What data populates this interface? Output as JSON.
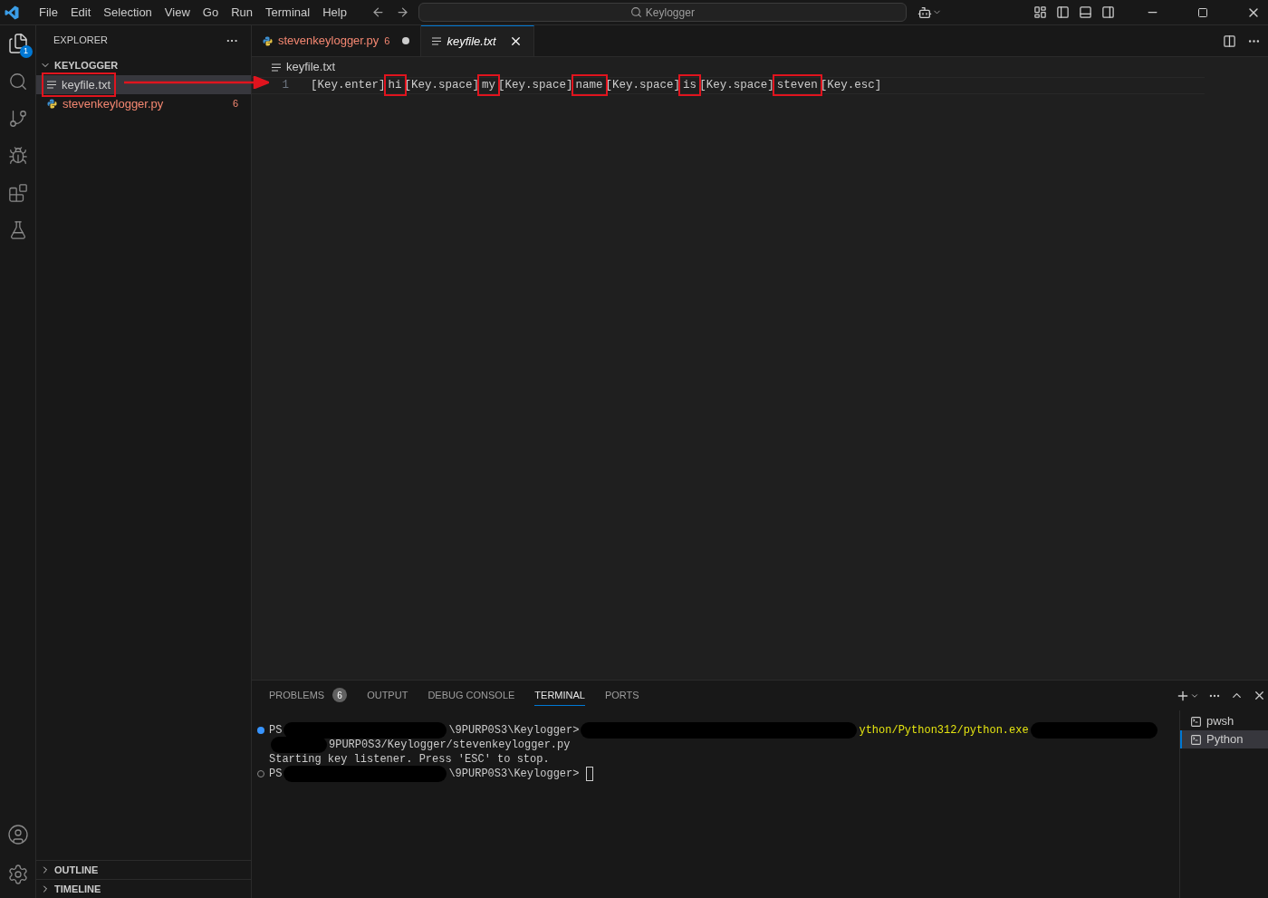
{
  "menu": [
    "File",
    "Edit",
    "Selection",
    "View",
    "Go",
    "Run",
    "Terminal",
    "Help"
  ],
  "command_center": {
    "value": "Keylogger"
  },
  "activity_bar": {
    "explorer_badge": "1"
  },
  "sidebar": {
    "title": "EXPLORER",
    "more": "···",
    "folder": {
      "label": "KEYLOGGER",
      "expanded": true,
      "items": [
        {
          "label": "keyfile.txt",
          "kind": "text",
          "selected": true,
          "annotated": true
        },
        {
          "label": "stevenkeylogger.py",
          "kind": "python",
          "selected": false,
          "annotated": false,
          "problems": "6"
        }
      ]
    },
    "sections": [
      {
        "label": "OUTLINE",
        "expanded": false
      },
      {
        "label": "TIMELINE",
        "expanded": false
      }
    ]
  },
  "editor_tabs": [
    {
      "label": "stevenkeylogger.py",
      "kind": "python",
      "problems": "6",
      "modified": true,
      "selected": false,
      "preview": false
    },
    {
      "label": "keyfile.txt",
      "kind": "text",
      "modified": false,
      "selected": true,
      "preview": true
    }
  ],
  "breadcrumb": "keyfile.txt",
  "code": {
    "line_number": "1",
    "segments": [
      {
        "text": "[Key.enter]",
        "annotated": false
      },
      {
        "text": "hi",
        "annotated": true
      },
      {
        "text": "[Key.space]",
        "annotated": false
      },
      {
        "text": "my",
        "annotated": true
      },
      {
        "text": "[Key.space]",
        "annotated": false
      },
      {
        "text": "name",
        "annotated": true
      },
      {
        "text": "[Key.space]",
        "annotated": false
      },
      {
        "text": "is",
        "annotated": true
      },
      {
        "text": "[Key.space]",
        "annotated": false
      },
      {
        "text": "steven",
        "annotated": true
      },
      {
        "text": "[Key.esc]",
        "annotated": false
      }
    ]
  },
  "panel": {
    "tabs": [
      {
        "label": "PROBLEMS",
        "badge": "6",
        "selected": false
      },
      {
        "label": "OUTPUT",
        "selected": false
      },
      {
        "label": "DEBUG CONSOLE",
        "selected": false
      },
      {
        "label": "TERMINAL",
        "selected": true
      },
      {
        "label": "PORTS",
        "selected": false
      }
    ],
    "terminal_lines": [
      {
        "prompt_dot": true,
        "succeeded": true,
        "segments": [
          {
            "kind": "text",
            "text": "PS"
          },
          {
            "kind": "redacted"
          },
          {
            "kind": "text",
            "text": "\\9PURP0S3\\Keylogger>"
          },
          {
            "kind": "redacted"
          },
          {
            "kind": "path",
            "text": "ython/Python312/python.exe"
          },
          {
            "kind": "redacted"
          }
        ]
      },
      {
        "segments": [
          {
            "kind": "redacted"
          },
          {
            "kind": "text",
            "text": "9PURP0S3/Keylogger/stevenkeylogger.py"
          }
        ]
      },
      {
        "segments": [
          {
            "kind": "text",
            "text": "Starting key listener. Press 'ESC' to stop."
          }
        ]
      },
      {
        "prompt_dot": true,
        "succeeded": false,
        "segments": [
          {
            "kind": "text",
            "text": "PS"
          },
          {
            "kind": "redacted"
          },
          {
            "kind": "text",
            "text": "\\9PURP0S3\\Keylogger>"
          },
          {
            "kind": "cursor"
          }
        ]
      }
    ],
    "terminals": [
      {
        "label": "pwsh",
        "selected": false
      },
      {
        "label": "Python",
        "selected": true
      }
    ]
  }
}
